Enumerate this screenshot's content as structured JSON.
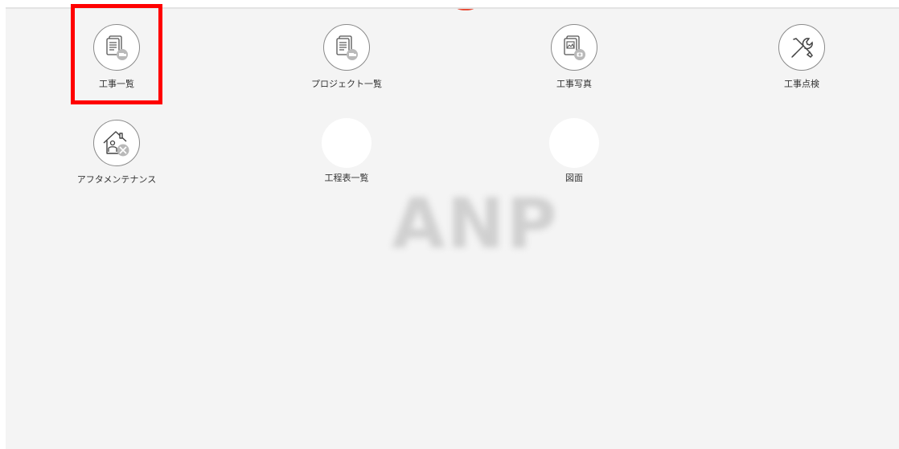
{
  "menu": {
    "tiles": [
      {
        "label": "工事一覧",
        "icon": "document-list-icon"
      },
      {
        "label": "プロジェクト一覧",
        "icon": "document-list-icon"
      },
      {
        "label": "工事写真",
        "icon": "photo-document-icon"
      },
      {
        "label": "工事点検",
        "icon": "tools-icon"
      },
      {
        "label": "アフタメンテナンス",
        "icon": "house-maintenance-icon"
      },
      {
        "label": "工程表一覧",
        "icon": "blank-icon"
      },
      {
        "label": "図面",
        "icon": "blank-icon"
      }
    ]
  },
  "watermark": {
    "text": "ANP"
  },
  "colors": {
    "background": "#f4f4f4",
    "highlight": "#ff0000",
    "accent": "#e8503b"
  }
}
